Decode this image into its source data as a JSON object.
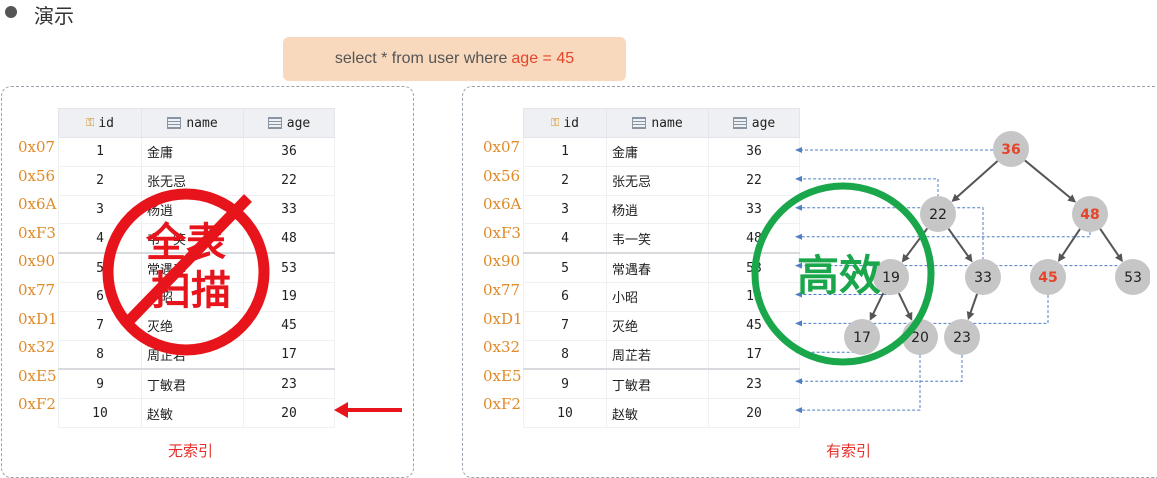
{
  "header": {
    "title": "演示"
  },
  "query": {
    "prefix": "select * from user where",
    "highlight": "age = 45"
  },
  "columns": {
    "id": "id",
    "name": "name",
    "age": "age"
  },
  "rows": [
    {
      "addr": "0x07",
      "id": "1",
      "name": "金庸",
      "age": "36"
    },
    {
      "addr": "0x56",
      "id": "2",
      "name": "张无忌",
      "age": "22"
    },
    {
      "addr": "0x6A",
      "id": "3",
      "name": "杨逍",
      "age": "33"
    },
    {
      "addr": "0xF3",
      "id": "4",
      "name": "韦一笑",
      "age": "48"
    },
    {
      "addr": "0x90",
      "id": "5",
      "name": "常遇春",
      "age": "53"
    },
    {
      "addr": "0x77",
      "id": "6",
      "name": "小昭",
      "age": "19"
    },
    {
      "addr": "0xD1",
      "id": "7",
      "name": "灭绝",
      "age": "45"
    },
    {
      "addr": "0x32",
      "id": "8",
      "name": "周芷若",
      "age": "17"
    },
    {
      "addr": "0xE5",
      "id": "9",
      "name": "丁敏君",
      "age": "23"
    },
    {
      "addr": "0xF2",
      "id": "10",
      "name": "赵敏",
      "age": "20"
    }
  ],
  "left": {
    "stamp_line1": "全表",
    "stamp_line2": "扫描",
    "caption": "无索引"
  },
  "right": {
    "stamp": "高效",
    "caption": "有索引"
  },
  "tree": {
    "nodes": [
      "36",
      "22",
      "48",
      "19",
      "33",
      "45",
      "53",
      "17",
      "20",
      "23"
    ],
    "highlighted": [
      "36",
      "48",
      "45"
    ]
  },
  "colors": {
    "accent": "#e5452b",
    "address": "#e08a28",
    "no_index": "#e5302b",
    "efficient": "#1aa64a",
    "node": "#c6c6c6"
  }
}
